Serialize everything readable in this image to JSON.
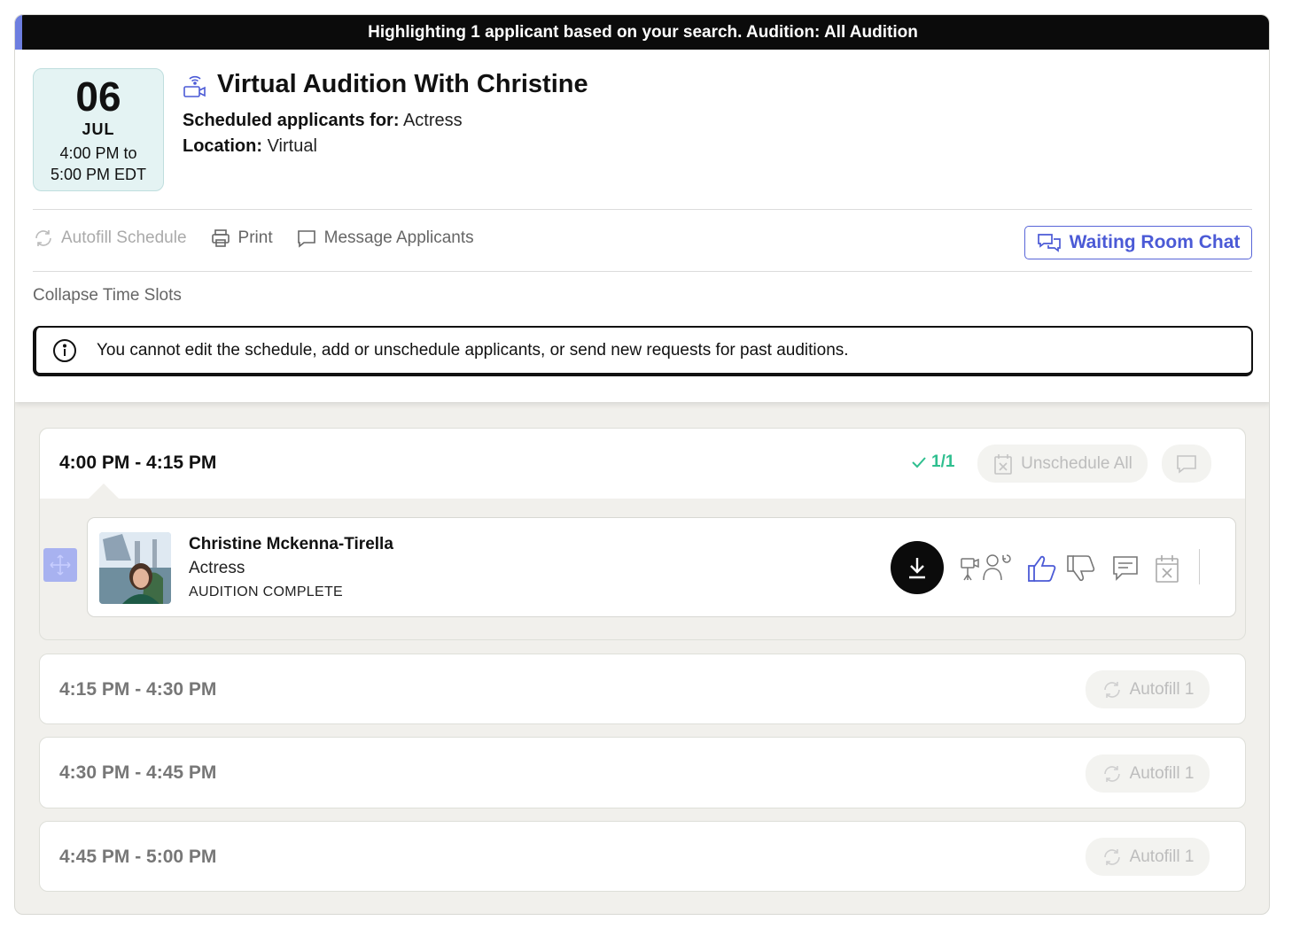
{
  "banner": {
    "text": "Highlighting 1 applicant based on your search. Audition: All Audition"
  },
  "event": {
    "day": "06",
    "month": "JUL",
    "time_line1": "4:00 PM to",
    "time_line2": "5:00 PM EDT",
    "title": "Virtual Audition With Christine",
    "scheduled_label": "Scheduled applicants for:",
    "scheduled_value": "Actress",
    "location_label": "Location:",
    "location_value": "Virtual"
  },
  "toolbar": {
    "autofill": "Autofill Schedule",
    "print": "Print",
    "message": "Message Applicants",
    "waiting_room": "Waiting Room Chat"
  },
  "collapse_label": "Collapse Time Slots",
  "notice": "You cannot edit the schedule, add or unschedule applicants, or send new requests for past auditions.",
  "slots": [
    {
      "time": "4:00 PM - 4:15 PM",
      "count": "1/1",
      "unschedule_label": "Unschedule All",
      "applicant": {
        "name": "Christine Mckenna-Tirella",
        "role": "Actress",
        "status": "AUDITION COMPLETE"
      }
    },
    {
      "time": "4:15 PM - 4:30 PM",
      "autofill_label": "Autofill 1"
    },
    {
      "time": "4:30 PM - 4:45 PM",
      "autofill_label": "Autofill 1"
    },
    {
      "time": "4:45 PM - 5:00 PM",
      "autofill_label": "Autofill 1"
    }
  ],
  "colors": {
    "accent": "#4b5ad6",
    "success": "#2fbf8f",
    "date_bg": "#e4f3f3",
    "banner_bg": "#0b0b0b"
  }
}
